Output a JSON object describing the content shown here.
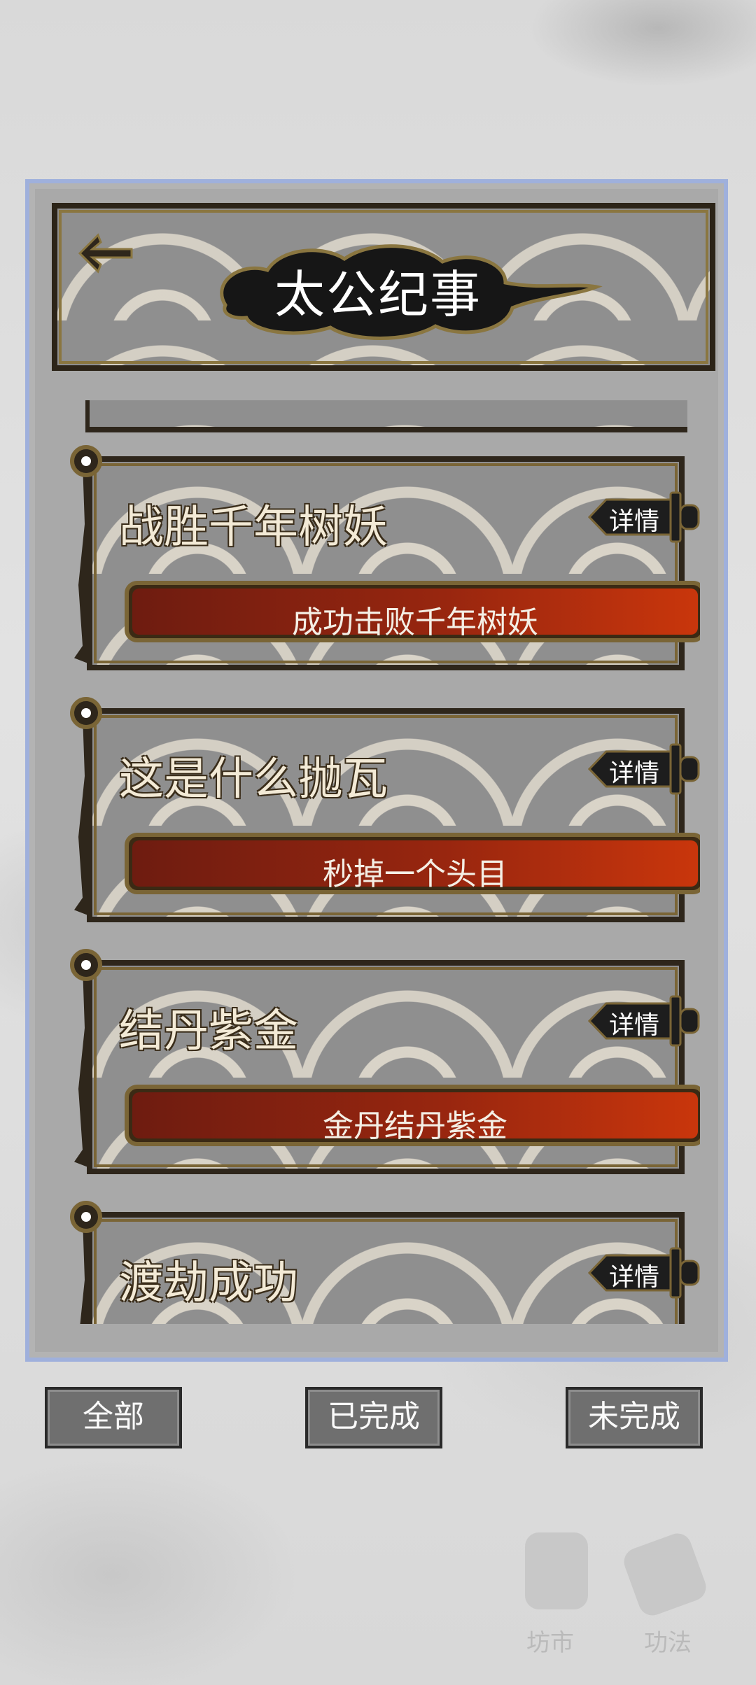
{
  "header": {
    "title": "太公纪事"
  },
  "background_nav": {
    "shop_label": "坊市",
    "skills_label": "功法"
  },
  "achievements": [
    {
      "title": "战胜千年树妖",
      "detail_label": "详情",
      "desc": "成功击败千年树妖"
    },
    {
      "title": "这是什么抛瓦",
      "detail_label": "详情",
      "desc": "秒掉一个头目"
    },
    {
      "title": "结丹紫金",
      "detail_label": "详情",
      "desc": "金丹结丹紫金"
    },
    {
      "title": "渡劫成功",
      "detail_label": "详情"
    }
  ],
  "filters": {
    "all_label": "全部",
    "done_label": "已完成",
    "undone_label": "未完成"
  },
  "colors": {
    "panel_border": "#9fb0dc",
    "bar_red": "#c9360c",
    "ink": "#2e261b",
    "gold_trim": "#7a6536"
  }
}
